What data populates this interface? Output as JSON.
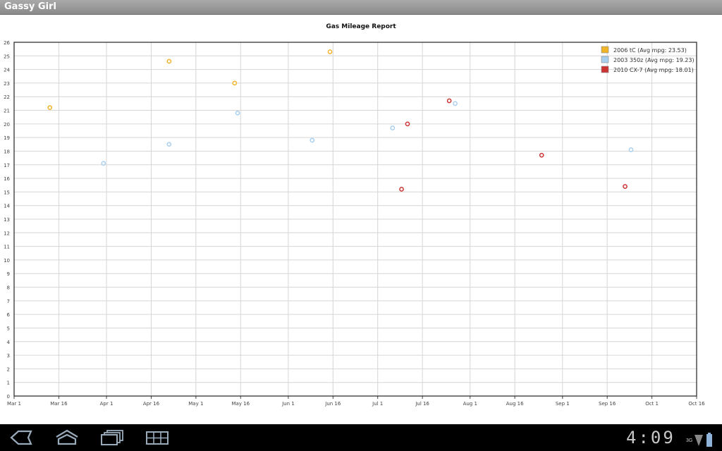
{
  "app": {
    "title": "Gassy Girl"
  },
  "status": {
    "time": "4:09",
    "network": "3G"
  },
  "chart_data": {
    "type": "scatter",
    "title": "Gas Mileage Report",
    "xlabel": "",
    "ylabel": "",
    "xlim": [
      "2010-03-01",
      "2010-10-16"
    ],
    "ylim": [
      0,
      26
    ],
    "grid": true,
    "legend_position": "top-right",
    "x_ticks": [
      "Mar 1",
      "Mar 16",
      "Apr 1",
      "Apr 16",
      "May 1",
      "May 16",
      "Jun 1",
      "Jun 16",
      "Jul 1",
      "Jul 16",
      "Aug 1",
      "Aug 16",
      "Sep 1",
      "Sep 16",
      "Oct 1",
      "Oct 16"
    ],
    "x_tick_dates": [
      "2010-03-01",
      "2010-03-16",
      "2010-04-01",
      "2010-04-16",
      "2010-05-01",
      "2010-05-16",
      "2010-06-01",
      "2010-06-16",
      "2010-07-01",
      "2010-07-16",
      "2010-08-01",
      "2010-08-16",
      "2010-09-01",
      "2010-09-16",
      "2010-10-01",
      "2010-10-16"
    ],
    "y_ticks": [
      0,
      1,
      2,
      3,
      4,
      5,
      6,
      7,
      8,
      9,
      10,
      11,
      12,
      13,
      14,
      15,
      16,
      17,
      18,
      19,
      20,
      21,
      22,
      23,
      24,
      25,
      26
    ],
    "series": [
      {
        "name": "2006 tC (Avg mpg: 23.53)",
        "color": "#f0b429",
        "points": [
          {
            "x": "2010-03-13",
            "y": 21.2
          },
          {
            "x": "2010-04-22",
            "y": 24.6
          },
          {
            "x": "2010-05-14",
            "y": 23.0
          },
          {
            "x": "2010-06-15",
            "y": 25.3
          }
        ]
      },
      {
        "name": "2003 350z (Avg mpg: 19.23)",
        "color": "#a9cfee",
        "points": [
          {
            "x": "2010-03-31",
            "y": 17.1
          },
          {
            "x": "2010-04-22",
            "y": 18.5
          },
          {
            "x": "2010-05-15",
            "y": 20.8
          },
          {
            "x": "2010-06-09",
            "y": 18.8
          },
          {
            "x": "2010-07-06",
            "y": 19.7
          },
          {
            "x": "2010-07-27",
            "y": 21.5
          },
          {
            "x": "2010-09-24",
            "y": 18.1
          }
        ]
      },
      {
        "name": "2010 CX-7 (Avg mpg: 18.01)",
        "color": "#cc3333",
        "points": [
          {
            "x": "2010-07-09",
            "y": 15.2
          },
          {
            "x": "2010-07-11",
            "y": 20.0
          },
          {
            "x": "2010-07-25",
            "y": 21.7
          },
          {
            "x": "2010-08-25",
            "y": 17.7
          },
          {
            "x": "2010-09-22",
            "y": 15.4
          }
        ]
      }
    ]
  }
}
